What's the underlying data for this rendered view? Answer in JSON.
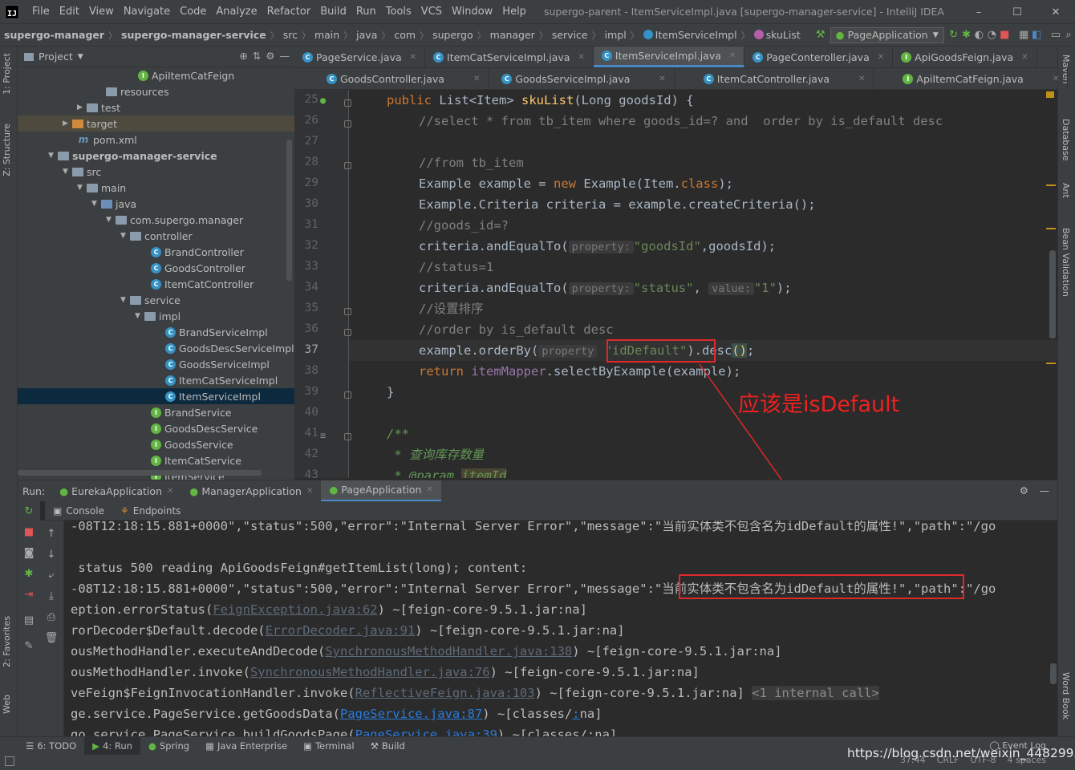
{
  "menubar": {
    "logo": "IJ",
    "items": [
      "File",
      "Edit",
      "View",
      "Navigate",
      "Code",
      "Analyze",
      "Refactor",
      "Build",
      "Run",
      "Tools",
      "VCS",
      "Window",
      "Help"
    ],
    "title": "supergo-parent - ItemServiceImpl.java [supergo-manager-service] - IntelliJ IDEA",
    "minimize": "–",
    "maximize": "☐",
    "close": "✕"
  },
  "navbar": {
    "crumbs": [
      "supergo-manager",
      "supergo-manager-service",
      "src",
      "main",
      "java",
      "com",
      "supergo",
      "manager",
      "service",
      "impl",
      "ItemServiceImpl",
      "skuList"
    ],
    "run_config": "PageApplication"
  },
  "left_strip": {
    "project": "1: Project",
    "structure": "Z: Structure",
    "favorites": "2: Favorites",
    "web": "Web"
  },
  "right_strip": {
    "maven": "Maven",
    "database": "Database",
    "ant": "Ant",
    "bean": "Bean Validation",
    "wordbook": "Word Book"
  },
  "project": {
    "title": "Project",
    "rows": [
      {
        "label": "ApiItemCatFeign",
        "icon": "interface"
      },
      {
        "label": "resources",
        "icon": "folder"
      },
      {
        "label": "test",
        "icon": "folder"
      },
      {
        "label": "target",
        "icon": "folder-orange"
      },
      {
        "label": "pom.xml",
        "icon": "maven"
      },
      {
        "label": "supergo-manager-service",
        "icon": "module"
      },
      {
        "label": "src",
        "icon": "folder"
      },
      {
        "label": "main",
        "icon": "folder"
      },
      {
        "label": "java",
        "icon": "folder-blue"
      },
      {
        "label": "com.supergo.manager",
        "icon": "package"
      },
      {
        "label": "controller",
        "icon": "package"
      },
      {
        "label": "BrandController",
        "icon": "class"
      },
      {
        "label": "GoodsController",
        "icon": "class"
      },
      {
        "label": "ItemCatController",
        "icon": "class"
      },
      {
        "label": "service",
        "icon": "package"
      },
      {
        "label": "impl",
        "icon": "package"
      },
      {
        "label": "BrandServiceImpl",
        "icon": "class"
      },
      {
        "label": "GoodsDescServiceImpl",
        "icon": "class"
      },
      {
        "label": "GoodsServiceImpl",
        "icon": "class"
      },
      {
        "label": "ItemCatServiceImpl",
        "icon": "class"
      },
      {
        "label": "ItemServiceImpl",
        "icon": "class"
      },
      {
        "label": "BrandService",
        "icon": "interface"
      },
      {
        "label": "GoodsDescService",
        "icon": "interface"
      },
      {
        "label": "GoodsService",
        "icon": "interface"
      },
      {
        "label": "ItemCatService",
        "icon": "interface"
      },
      {
        "label": "ItemService",
        "icon": "interface"
      }
    ]
  },
  "editor_tabs_row1": [
    {
      "label": "PageService.java",
      "icon": "class"
    },
    {
      "label": "ItemCatServiceImpl.java",
      "icon": "class"
    },
    {
      "label": "ItemServiceImpl.java",
      "icon": "class",
      "active": true
    },
    {
      "label": "PageConteroller.java",
      "icon": "class"
    },
    {
      "label": "ApiGoodsFeign.java",
      "icon": "interface"
    }
  ],
  "editor_tabs_row2": [
    {
      "label": "GoodsController.java",
      "icon": "class"
    },
    {
      "label": "GoodsServiceImpl.java",
      "icon": "class"
    },
    {
      "label": "ItemCatController.java",
      "icon": "class"
    },
    {
      "label": "ApiItemCatFeign.java",
      "icon": "interface"
    }
  ],
  "editor": {
    "line_numbers": [
      "25",
      "26",
      "27",
      "28",
      "29",
      "30",
      "31",
      "32",
      "33",
      "34",
      "35",
      "36",
      "37",
      "38",
      "39",
      "40",
      "41",
      "42",
      "43"
    ],
    "current_line": "37",
    "code": {
      "l25_kw": "public ",
      "l25_type": "List<Item> ",
      "l25_fn": "skuList",
      "l25_rest": "(Long goodsId) {",
      "l26": "//select * from tb_item where goods_id=? and  order by is_default desc",
      "l28": "//from tb_item",
      "l29_a": "Example example = ",
      "l29_new": "new ",
      "l29_b": "Example(Item.",
      "l29_cls": "class",
      "l29_c": ");",
      "l30": "Example.Criteria criteria = example.createCriteria();",
      "l31": "//goods_id=?",
      "l32_a": "criteria.andEqualTo(",
      "l32_hint": "property:",
      "l32_str": "\"goodsId\"",
      "l32_b": ",goodsId);",
      "l33": "//status=1",
      "l34_a": "criteria.andEqualTo(",
      "l34_hint": "property:",
      "l34_str": "\"status\"",
      "l34_comma": ",",
      "l34_hint2": "value:",
      "l34_str2": "\"1\"",
      "l34_b": ");",
      "l35": "//设置排序",
      "l36": "//order by is_default desc",
      "l37_a": "example.orderBy(",
      "l37_hint": "property",
      "l37_str": "\"idDefault\"",
      "l37_b": ").desc",
      "l37_paren": "()",
      "l37_c": ";",
      "l38_kw": "return ",
      "l38_field": "itemMapper",
      "l38_rest": ".selectByExample(example);",
      "l39": "}",
      "l41": "/**",
      "l42": " * 查询库存数量",
      "l43_a": " * @param ",
      "l43_b": "itemId"
    },
    "annotation": "应该是isDefault"
  },
  "run": {
    "label": "Run:",
    "tabs": [
      "EurekaApplication",
      "ManagerApplication",
      "PageApplication"
    ],
    "active_tab": "PageApplication",
    "console_tab": "Console",
    "endpoints_tab": "Endpoints"
  },
  "console": {
    "lines": [
      {
        "text": "-08T12:18:15.881+0000\",\"status\":500,\"error\":\"Internal Server Error\",\"message\":\"当前实体类不包含名为idDefault的属性!\",\"path\":\"/go"
      },
      {
        "text": ""
      },
      {
        "text": " status 500 reading ApiGoodsFeign#getItemList(long); content:"
      },
      {
        "text_a": "-08T12:18:15.881+0000\",\"status\":500,\"error\":\"Internal Server Error\",\"message\"",
        "text_b": ":\"当前实体类不包含名为idDefault的属性!\"",
        "text_c": ",\"path\":\"/go"
      },
      {
        "pre": "eption.errorStatus(",
        "link": "FeignException.java:62",
        "post": ") ~[feign-core-9.5.1.jar:na]"
      },
      {
        "pre": "rorDecoder$Default.decode(",
        "link": "ErrorDecoder.java:91",
        "post": ") ~[feign-core-9.5.1.jar:na]"
      },
      {
        "pre": "ousMethodHandler.executeAndDecode(",
        "link": "SynchronousMethodHandler.java:138",
        "post": ") ~[feign-core-9.5.1.jar:na]"
      },
      {
        "pre": "ousMethodHandler.invoke(",
        "link": "SynchronousMethodHandler.java:76",
        "post": ") ~[feign-core-9.5.1.jar:na]"
      },
      {
        "pre": "veFeign$FeignInvocationHandler.invoke(",
        "link": "ReflectiveFeign.java:103",
        "post": ") ~[feign-core-9.5.1.jar:na] ",
        "fold": "<1 internal call>"
      },
      {
        "pre": "ge.service.PageService.getGoodsData(",
        "link": "PageService.java:87",
        "post": ") ~[classes/",
        "link2": ":",
        "post2": "na]"
      },
      {
        "pre": "go.service.PageService.buildGoodsPage(",
        "link": "PageService.java:39",
        "post": ") ~[classes/:na]"
      }
    ]
  },
  "bottom_tabs": [
    "6: TODO",
    "4: Run",
    "Spring",
    "Java Enterprise",
    "Terminal",
    "Build"
  ],
  "status": {
    "event_log": "Event Log",
    "position": "37:44",
    "crlf": "CRLF",
    "encoding": "UTF-8",
    "indent": "4 spaces"
  },
  "watermark": "https://blog.csdn.net/weixin_44829930",
  "colors": {
    "accent": "#4a88c7",
    "annotation": "#e0282c",
    "selection": "#0d293e"
  }
}
